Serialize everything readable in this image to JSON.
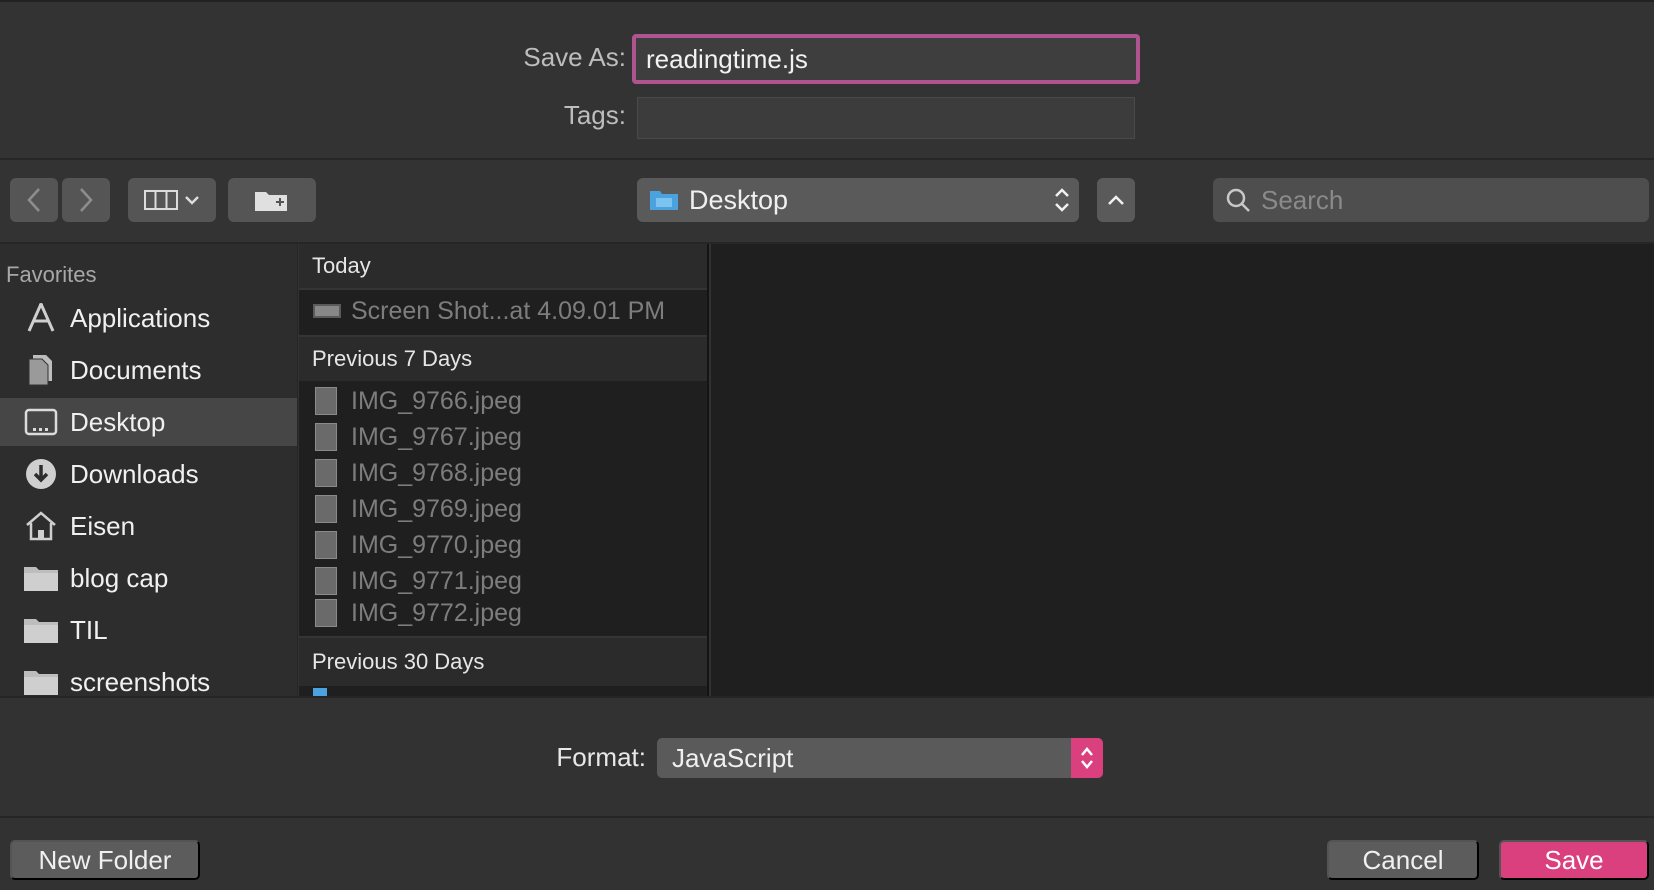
{
  "dialog": {
    "save_as_label": "Save As:",
    "save_as_value": "readingtime.js",
    "tags_label": "Tags:",
    "tags_value": ""
  },
  "toolbar": {
    "location": "Desktop",
    "search_placeholder": "Search"
  },
  "sidebar": {
    "heading": "Favorites",
    "items": [
      {
        "label": "Applications",
        "icon": "applications-icon"
      },
      {
        "label": "Documents",
        "icon": "documents-icon"
      },
      {
        "label": "Desktop",
        "icon": "desktop-icon",
        "selected": true
      },
      {
        "label": "Downloads",
        "icon": "downloads-icon"
      },
      {
        "label": "Eisen",
        "icon": "home-icon"
      },
      {
        "label": "blog cap",
        "icon": "folder-icon"
      },
      {
        "label": "TIL",
        "icon": "folder-icon"
      },
      {
        "label": "screenshots",
        "icon": "folder-icon"
      }
    ]
  },
  "files": {
    "groups": [
      {
        "title": "Today",
        "items": [
          "Screen Shot...at 4.09.01 PM"
        ]
      },
      {
        "title": "Previous 7 Days",
        "items": [
          "IMG_9766.jpeg",
          "IMG_9767.jpeg",
          "IMG_9768.jpeg",
          "IMG_9769.jpeg",
          "IMG_9770.jpeg",
          "IMG_9771.jpeg",
          "IMG_9772.jpeg"
        ]
      },
      {
        "title": "Previous 30 Days",
        "items": []
      }
    ]
  },
  "format": {
    "label": "Format:",
    "value": "JavaScript"
  },
  "buttons": {
    "new_folder": "New Folder",
    "cancel": "Cancel",
    "save": "Save"
  },
  "colors": {
    "accent": "#d9407d",
    "focus_ring": "#b0548f",
    "folder_blue": "#4aa3df"
  }
}
